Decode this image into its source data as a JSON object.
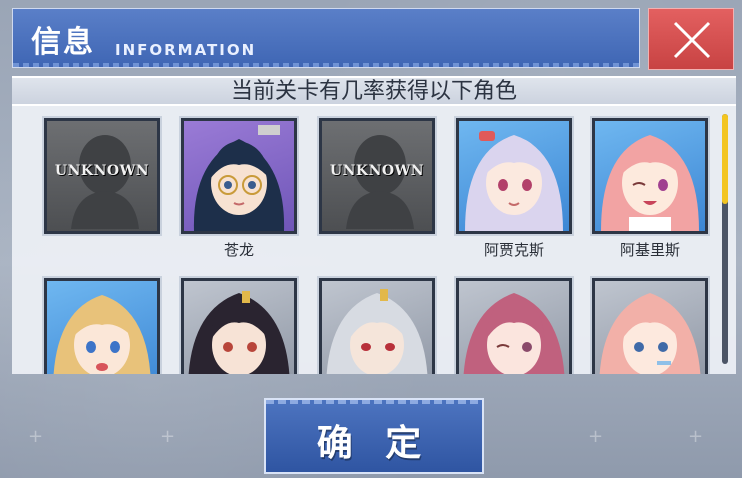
{
  "header": {
    "title_cn": "信息",
    "title_en": "INFORMATION"
  },
  "subtitle": "当前关卡有几率获得以下角色",
  "characters": [
    {
      "label": "UNKNOWN",
      "name": "",
      "known": false
    },
    {
      "label": "",
      "name": "苍龙",
      "known": true,
      "frame": "purple"
    },
    {
      "label": "UNKNOWN",
      "name": "",
      "known": false
    },
    {
      "label": "",
      "name": "阿贾克斯",
      "known": true,
      "frame": "blue"
    },
    {
      "label": "",
      "name": "阿基里斯",
      "known": true,
      "frame": "blue"
    },
    {
      "label": "",
      "name": "",
      "known": true,
      "frame": "blue"
    },
    {
      "label": "",
      "name": "",
      "known": true,
      "frame": "grey"
    },
    {
      "label": "",
      "name": "",
      "known": true,
      "frame": "grey"
    },
    {
      "label": "",
      "name": "",
      "known": true,
      "frame": "grey"
    },
    {
      "label": "",
      "name": "",
      "known": true,
      "frame": "grey"
    }
  ],
  "confirm_button": {
    "label": "确 定"
  },
  "icons": {
    "close": "close-icon",
    "unknown": "silhouette-icon"
  },
  "colors": {
    "title_bg": "#4a6fbd",
    "close_bg": "#d24d4d",
    "scroll_thumb": "#f3c521",
    "confirm_bg": "#3d62b0"
  }
}
